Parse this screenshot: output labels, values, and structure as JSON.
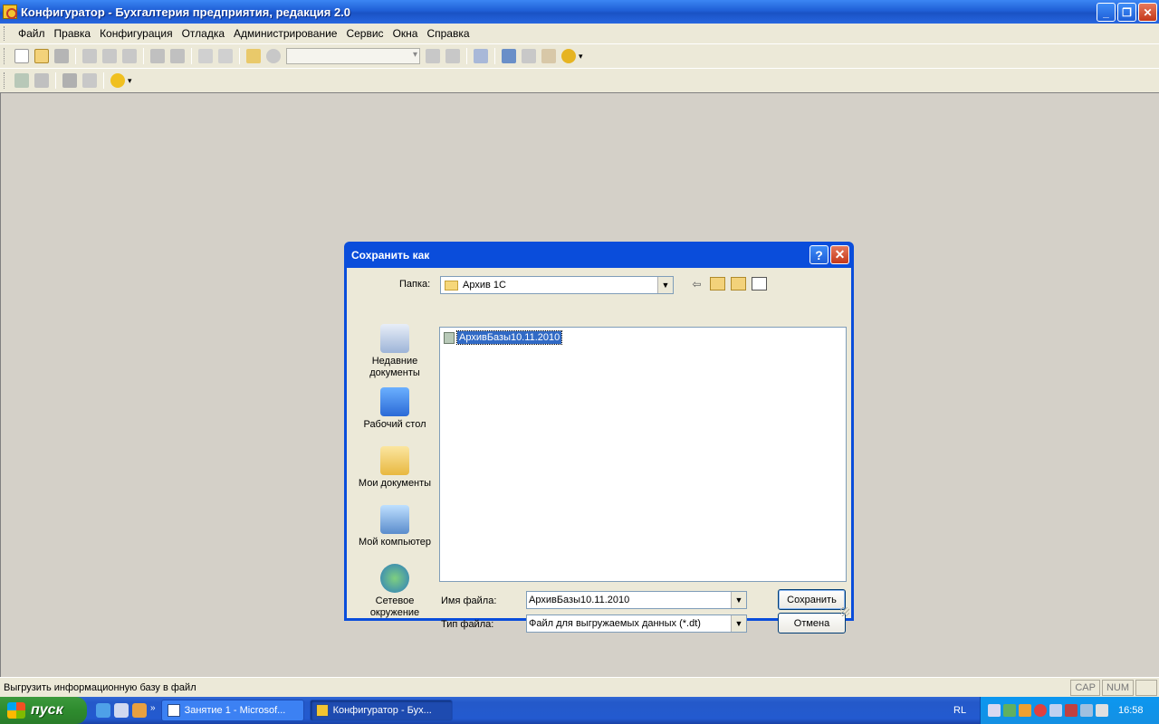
{
  "window": {
    "title": "Конфигуратор - Бухгалтерия предприятия, редакция 2.0",
    "buttons": {
      "minimize": "_",
      "restore": "❐",
      "close": "✕"
    }
  },
  "menu": {
    "items": [
      "Файл",
      "Правка",
      "Конфигурация",
      "Отладка",
      "Администрирование",
      "Сервис",
      "Окна",
      "Справка"
    ]
  },
  "dialog": {
    "title": "Сохранить как",
    "help_button": "?",
    "close_button": "✕",
    "folder_label": "Папка:",
    "folder_value": "Архив 1С",
    "places": [
      {
        "line1": "Недавние",
        "line2": "документы"
      },
      {
        "line1": "Рабочий стол",
        "line2": ""
      },
      {
        "line1": "Мои документы",
        "line2": ""
      },
      {
        "line1": "Мой компьютер",
        "line2": ""
      },
      {
        "line1": "Сетевое",
        "line2": "окружение"
      }
    ],
    "files": [
      "АрхивБазы10.11.2010"
    ],
    "filename_label": "Имя файла:",
    "filename_value": "АрхивБазы10.11.2010",
    "filetype_label": "Тип файла:",
    "filetype_value": "Файл для выгружаемых данных (*.dt)",
    "save_button": "Сохранить",
    "cancel_button": "Отмена"
  },
  "status": {
    "text": "Выгрузить информационную базу в файл",
    "cap": "CAP",
    "num": "NUM"
  },
  "taskbar": {
    "start_label": "пуск",
    "tasks": [
      {
        "label": "Занятие 1 - Microsof...",
        "active": false
      },
      {
        "label": "Конфигуратор - Бух...",
        "active": true
      }
    ],
    "language": "RL",
    "clock": "16:58"
  },
  "colors": {
    "titlebar": "#1f5fd6",
    "dialog_frame": "#0a4ddb",
    "selection": "#316ac5",
    "taskbar": "#235ad0",
    "start_button": "#2e8b2e"
  }
}
